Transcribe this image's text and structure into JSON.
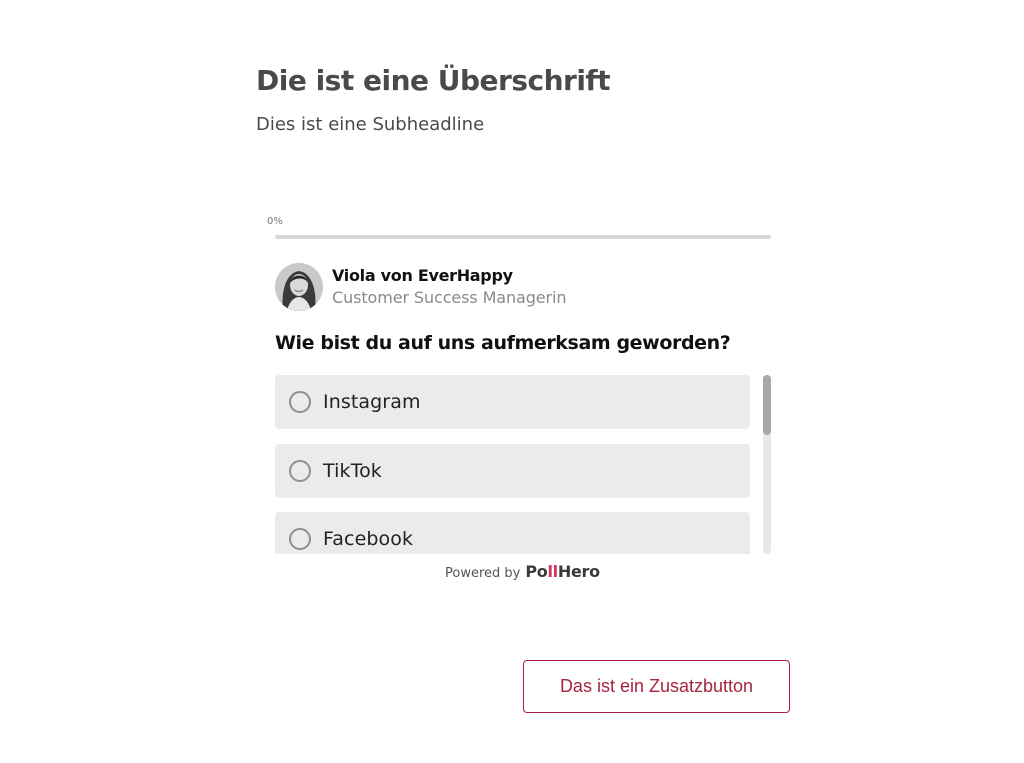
{
  "header": {
    "title": "Die ist eine Überschrift",
    "subtitle": "Dies ist eine Subheadline"
  },
  "poll": {
    "progress": {
      "label": "0%",
      "value": 0
    },
    "author": {
      "name": "Viola von EverHappy",
      "role": "Customer Success Managerin",
      "avatar_icon": "person-photo"
    },
    "question": "Wie bist du auf uns aufmerksam geworden?",
    "options": [
      {
        "label": "Instagram",
        "selected": false
      },
      {
        "label": "TikTok",
        "selected": false
      },
      {
        "label": "Facebook",
        "selected": false
      }
    ],
    "footer": {
      "powered_by": "Powered by",
      "brand": "PollHero",
      "brand_accent_color": "#d0375a"
    }
  },
  "extra_button": {
    "label": "Das ist ein Zusatzbutton",
    "color": "#a8233f"
  }
}
